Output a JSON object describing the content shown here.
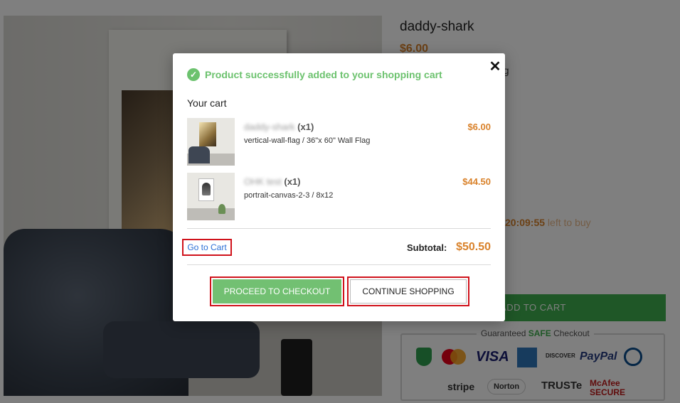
{
  "product": {
    "title": "daddy-shark",
    "price": "$6.00",
    "variant_fragment": "ag",
    "timer_value": "20:09:55",
    "timer_suffix": " left to buy",
    "add_to_cart_label": "ADD TO CART"
  },
  "trust": {
    "title_prefix": "Guaranteed ",
    "title_highlight": "SAFE",
    "title_suffix": " Checkout",
    "badges": [
      "mastercard",
      "VISA",
      "AMERICAN EXPRESS",
      "DISCOVER",
      "PayPal",
      "Diners Club",
      "stripe",
      "Norton",
      "TRUSTe",
      "McAfee SECURE"
    ]
  },
  "modal": {
    "close_glyph": "✕",
    "success_message": "Product successfully added to your shopping cart",
    "cart_heading": "Your cart",
    "items": [
      {
        "name": "daddy-shark",
        "qty": "(x1)",
        "variant": "vertical-wall-flag / 36\"x 60\" Wall Flag",
        "price": "$6.00"
      },
      {
        "name": "OHK test",
        "qty": "(x1)",
        "variant": "portrait-canvas-2-3 / 8x12",
        "price": "$44.50"
      }
    ],
    "go_to_cart": "Go to Cart",
    "subtotal_label": "Subtotal:",
    "subtotal_value": "$50.50",
    "checkout_label": "PROCEED TO CHECKOUT",
    "continue_label": "CONTINUE SHOPPING"
  },
  "colors": {
    "accent_orange": "#d9822b",
    "success_green": "#6cc26e",
    "checkout_green": "#72c072",
    "add_to_cart_green": "#3fae4e",
    "highlight_red": "#d0121b",
    "link_blue": "#2a6fd6"
  }
}
